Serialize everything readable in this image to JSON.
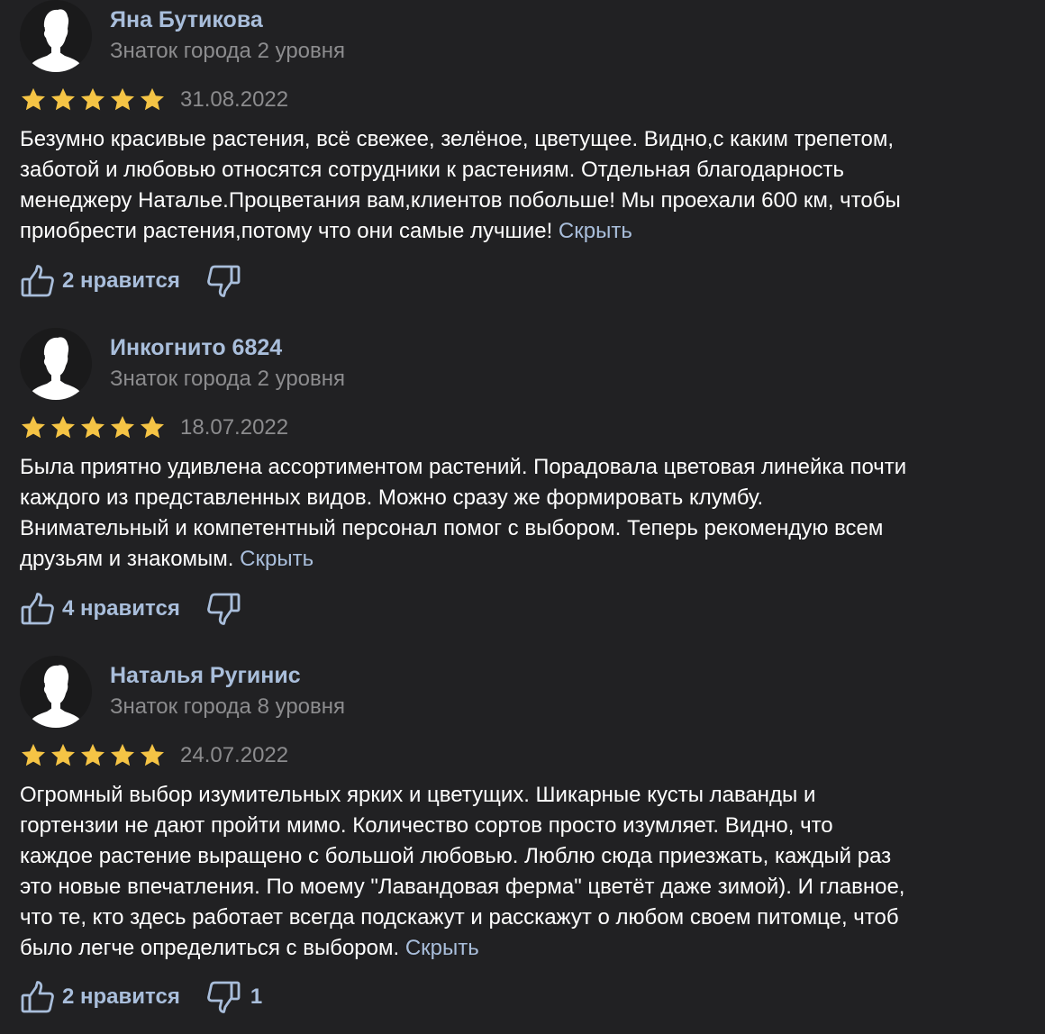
{
  "colors": {
    "background": "#212123",
    "accent": "#a9bedb",
    "muted": "#8c8c8e",
    "star": "#f5c445"
  },
  "reviews": [
    {
      "author": "Яна Бутикова",
      "level": "Знаток города 2 уровня",
      "rating": 5,
      "date": "31.08.2022",
      "text_lines": [
        "Безумно красивые растения, всё свежее, зелёное, цветущее. Видно,с каким трепетом,",
        "заботой и любовью относятся сотрудники к растениям. Отдельная благодарность",
        "менеджеру Наталье.Процветания вам,клиентов побольше! Мы проехали 600 км, чтобы",
        "приобрести растения,потому что они самые лучшие!"
      ],
      "hide_label": "Скрыть",
      "likes_label": "2 нравится",
      "dislikes": ""
    },
    {
      "author": "Инкогнито 6824",
      "level": "Знаток города 2 уровня",
      "rating": 5,
      "date": "18.07.2022",
      "text_lines": [
        "Была приятно удивлена ассортиментом растений. Порадовала цветовая линейка почти",
        "каждого из представленных видов. Можно сразу же формировать клумбу.",
        "Внимательный и компетентный персонал помог с выбором. Теперь рекомендую всем",
        "друзьям и знакомым."
      ],
      "hide_label": "Скрыть",
      "likes_label": "4 нравится",
      "dislikes": ""
    },
    {
      "author": "Наталья Ругинис",
      "level": "Знаток города 8 уровня",
      "rating": 5,
      "date": "24.07.2022",
      "text_lines": [
        "Огромный выбор изумительных ярких и цветущих. Шикарные кусты лаванды и",
        "гортензии не дают пройти мимо. Количество сортов просто изумляет. Видно, что",
        "каждое растение выращено с большой любовью. Люблю сюда приезжать, каждый раз",
        "это новые впечатления. По моему \"Лавандовая ферма\" цветёт даже зимой). И главное,",
        "что те, кто здесь работает всегда подскажут и расскажут о любом своем питомце, чтоб",
        "было легче определиться с выбором."
      ],
      "hide_label": "Скрыть",
      "likes_label": "2 нравится",
      "dislikes": "1"
    }
  ]
}
